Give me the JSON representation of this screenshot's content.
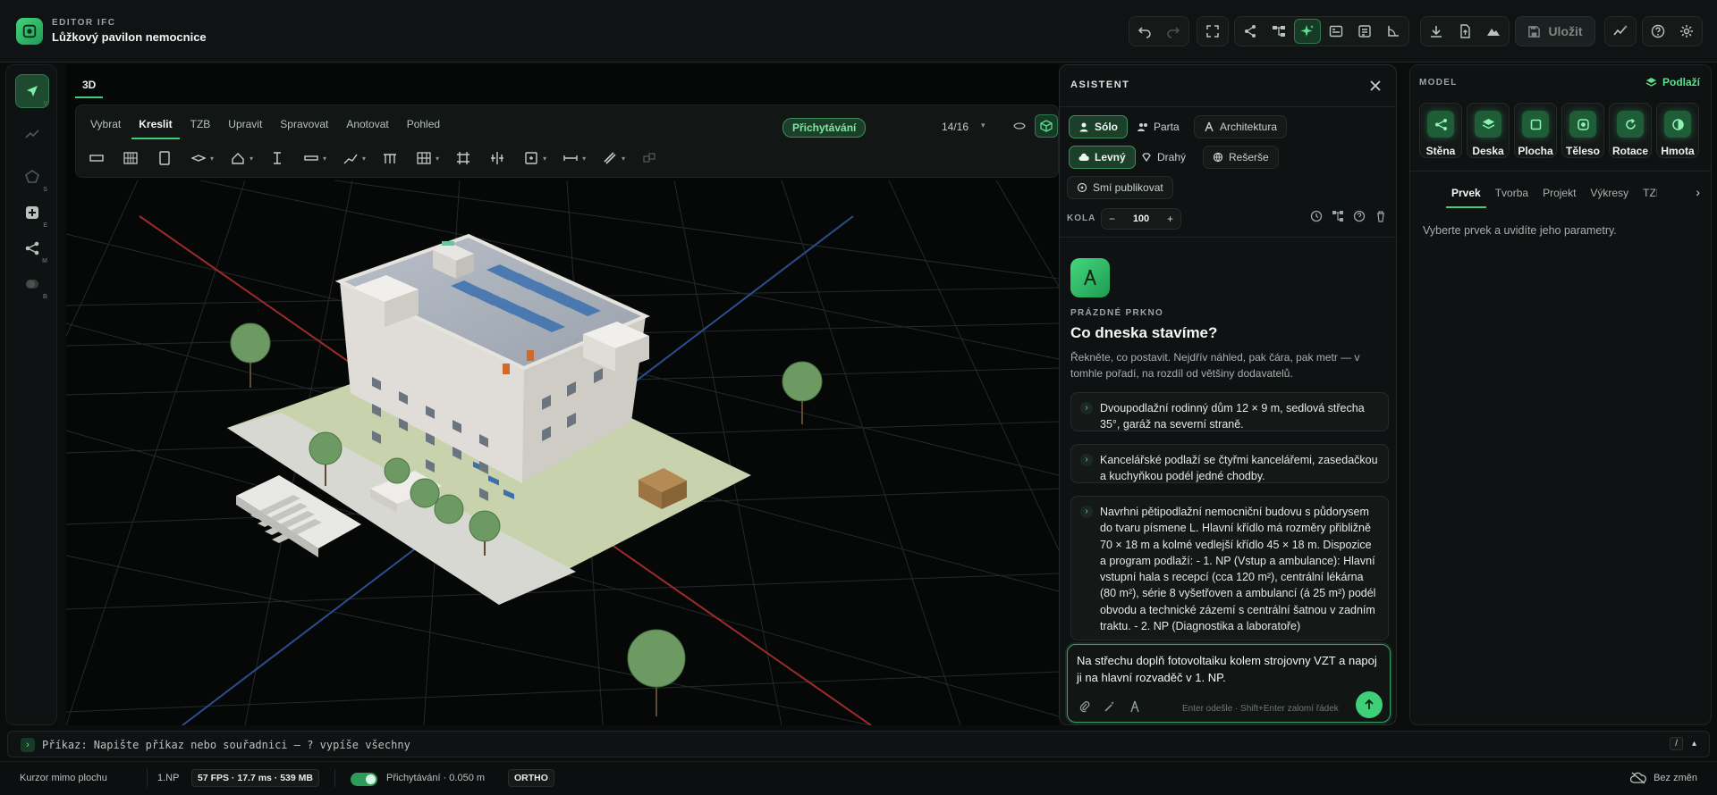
{
  "app": {
    "kicker": "EDITOR IFC",
    "title": "Lůžkový pavilon nemocnice"
  },
  "toolbar": {
    "save_label": "Uložit"
  },
  "rail": {
    "keys": [
      "V",
      "",
      "S",
      "E",
      "M",
      "B"
    ]
  },
  "viewport": {
    "tab": "3D",
    "tool_tabs": [
      "Vybrat",
      "Kreslit",
      "TZB",
      "Upravit",
      "Spravovat",
      "Anotovat",
      "Pohled"
    ],
    "active_tool_tab": "Kreslit",
    "snap_label": "Přichytávání",
    "snap_count": "14/16"
  },
  "assistant": {
    "title": "ASISTENT",
    "modes": [
      "Sólo",
      "Parta",
      "Architektura"
    ],
    "models": [
      "Levný",
      "Drahý",
      "Rešerše"
    ],
    "publish": "Smí publikovat",
    "kola_label": "KOLA",
    "kola_value": "100",
    "hero_kicker": "PRÁZDNÉ PRKNO",
    "hero_title": "Co dneska stavíme?",
    "hero_desc": "Řekněte, co postavit. Nejdřív náhled, pak čára, pak metr — v tomhle pořadí, na rozdíl od většiny dodavatelů.",
    "suggestions": [
      "Dvoupodlažní rodinný dům 12 × 9 m, sedlová střecha 35°, garáž na severní straně.",
      "Kancelářské podlaží se čtyřmi kancelářemi, zasedačkou a kuchyňkou podél jedné chodby.",
      "Navrhni pětipodlažní nemocniční budovu s půdorysem do tvaru písmene L. Hlavní křídlo má rozměry přibližně 70 × 18 m a kolmé vedlejší křídlo 45 × 18 m. Dispozice a program podlaží: - 1. NP (Vstup a ambulance): Hlavní vstupní hala s recepcí (cca 120 m²), centrální lékárna (80 m²), série 8 vyšetřoven a ambulancí (á 25 m²) podél obvodu a technické zázemí s centrální šatnou v zadním traktu. - 2. NP (Diagnostika a laboratoře)"
    ],
    "composer_text": "Na střechu doplň fotovoltaiku kolem strojovny VZT a napoj ji na hlavní rozvaděč v 1. NP.",
    "composer_hint": "Enter odešle · Shift+Enter zalomí řádek"
  },
  "props": {
    "title": "MODEL",
    "level": "Podlaží",
    "tiles": [
      "Stěna",
      "Deska",
      "Plocha",
      "Těleso",
      "Rotace",
      "Hmota"
    ],
    "tabs": [
      "Prvek",
      "Tvorba",
      "Projekt",
      "Výkresy",
      "TZB"
    ],
    "active_tab": "Prvek",
    "empty": "Vyberte prvek a uvidíte jeho parametry."
  },
  "command": {
    "text": "Příkaz: Napište příkaz nebo souřadnici — ? vypíše všechny",
    "kbd": "/"
  },
  "status": {
    "cursor": "Kurzor mimo plochu",
    "level": "1.NP",
    "fps": "57 FPS · 17.7 ms · 539 MB",
    "snap": "Přichytávání · 0.050 m",
    "ortho": "ORTHO",
    "changes": "Bez změn"
  }
}
